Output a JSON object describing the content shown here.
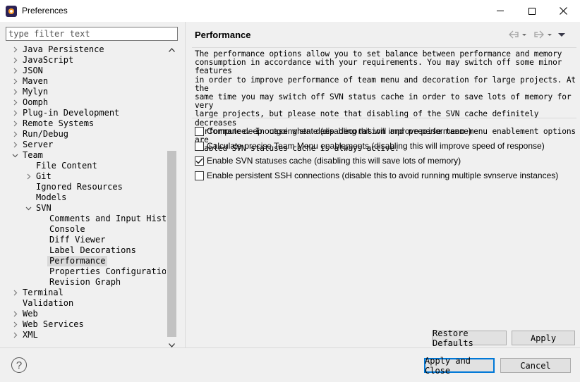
{
  "window": {
    "title": "Preferences",
    "icon": "eclipse-app-icon"
  },
  "filter": {
    "placeholder": "type filter text",
    "value": ""
  },
  "tree": [
    {
      "label": "Java Persistence",
      "level": 0,
      "arrow": "collapsed"
    },
    {
      "label": "JavaScript",
      "level": 0,
      "arrow": "collapsed"
    },
    {
      "label": "JSON",
      "level": 0,
      "arrow": "collapsed"
    },
    {
      "label": "Maven",
      "level": 0,
      "arrow": "collapsed"
    },
    {
      "label": "Mylyn",
      "level": 0,
      "arrow": "collapsed"
    },
    {
      "label": "Oomph",
      "level": 0,
      "arrow": "collapsed"
    },
    {
      "label": "Plug-in Development",
      "level": 0,
      "arrow": "collapsed"
    },
    {
      "label": "Remote Systems",
      "level": 0,
      "arrow": "collapsed"
    },
    {
      "label": "Run/Debug",
      "level": 0,
      "arrow": "collapsed"
    },
    {
      "label": "Server",
      "level": 0,
      "arrow": "collapsed"
    },
    {
      "label": "Team",
      "level": 0,
      "arrow": "expanded"
    },
    {
      "label": "File Content",
      "level": 1,
      "arrow": "none"
    },
    {
      "label": "Git",
      "level": 1,
      "arrow": "collapsed"
    },
    {
      "label": "Ignored Resources",
      "level": 1,
      "arrow": "none"
    },
    {
      "label": "Models",
      "level": 1,
      "arrow": "none"
    },
    {
      "label": "SVN",
      "level": 1,
      "arrow": "expanded"
    },
    {
      "label": "Comments and Input History",
      "level": 2,
      "arrow": "none"
    },
    {
      "label": "Console",
      "level": 2,
      "arrow": "none"
    },
    {
      "label": "Diff Viewer",
      "level": 2,
      "arrow": "none"
    },
    {
      "label": "Label Decorations",
      "level": 2,
      "arrow": "none"
    },
    {
      "label": "Performance",
      "level": 2,
      "arrow": "none",
      "selected": true
    },
    {
      "label": "Properties Configuration",
      "level": 2,
      "arrow": "none"
    },
    {
      "label": "Revision Graph",
      "level": 2,
      "arrow": "none"
    },
    {
      "label": "Terminal",
      "level": 0,
      "arrow": "collapsed"
    },
    {
      "label": "Validation",
      "level": 0,
      "arrow": "none"
    },
    {
      "label": "Web",
      "level": 0,
      "arrow": "collapsed"
    },
    {
      "label": "Web Services",
      "level": 0,
      "arrow": "collapsed"
    },
    {
      "label": "XML",
      "level": 0,
      "arrow": "collapsed"
    }
  ],
  "page": {
    "title": "Performance",
    "description": [
      "The performance options allow you to set balance between performance and memory",
      "consumption in accordance with your requirements. You may switch off some minor features",
      "in order to improve performance of team menu and decoration for large projects. At the",
      "same time you may switch off SVN status cache in order to save lots of memory for very",
      "large projects, but please note that disabling of the SVN cache definitely decreases",
      "performance. In case when deep decoration and precise team menu enablement options are",
      "enabled SVN statuses cache is always active."
    ],
    "options": [
      {
        "label": "Compute deep outgoing state (disabling this will improve performance)",
        "checked": false
      },
      {
        "label": "Calculate precise Team Menu enablements (disabling this will improve speed of response)",
        "checked": false
      },
      {
        "label": "Enable SVN statuses cache (disabling this will save lots of memory)",
        "checked": true
      },
      {
        "label": "Enable persistent SSH connections (disable this to avoid running multiple svnserve instances)",
        "checked": false
      }
    ],
    "restore_defaults_label": "Restore Defaults",
    "apply_label": "Apply"
  },
  "footer": {
    "help_label": "?",
    "apply_close_label": "Apply and Close",
    "cancel_label": "Cancel"
  },
  "colors": {
    "selection": "#d9d9d9",
    "default_button_border": "#0078d7"
  }
}
